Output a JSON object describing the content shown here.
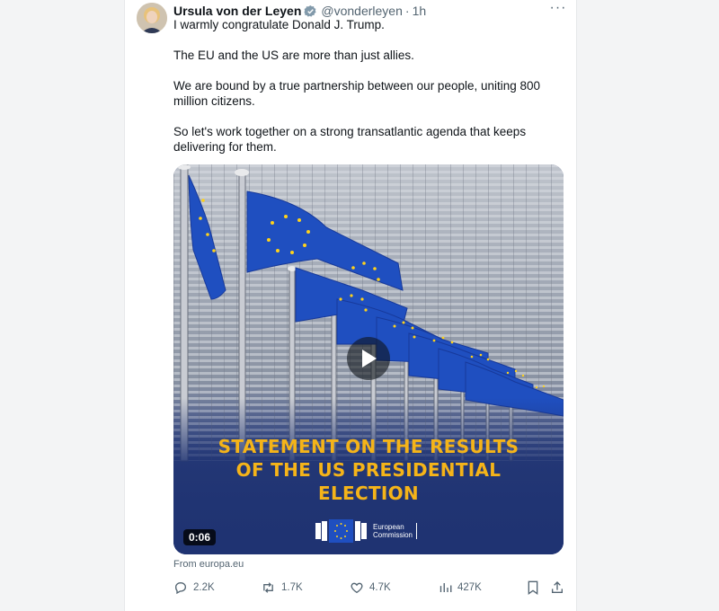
{
  "tweet": {
    "author_name": "Ursula von der Leyen",
    "handle": "@vonderleyen",
    "separator": "·",
    "time": "1h",
    "more_label": "···",
    "paragraphs": [
      "I warmly congratulate Donald J. Trump.",
      "The EU and the US are more than just allies.",
      "We are bound by a true partnership between our people, uniting 800 million citizens.",
      "So let's work together on a strong transatlantic agenda that keeps delivering for them."
    ]
  },
  "media": {
    "headline_line1": "STATEMENT ON THE RESULTS",
    "headline_line2": "OF THE US PRESIDENTIAL",
    "headline_line3": "ELECTION",
    "duration": "0:06",
    "logo_line1": "European",
    "logo_line2": "Commission",
    "headline_color": "#f5b419",
    "flag_color": "#1f4fc0"
  },
  "source": "From europa.eu",
  "metrics": {
    "replies": "2.2K",
    "reposts": "1.7K",
    "likes": "4.7K",
    "views": "427K"
  },
  "colors": {
    "text": "#0f1419",
    "muted": "#536471",
    "verified": "#829aab"
  }
}
